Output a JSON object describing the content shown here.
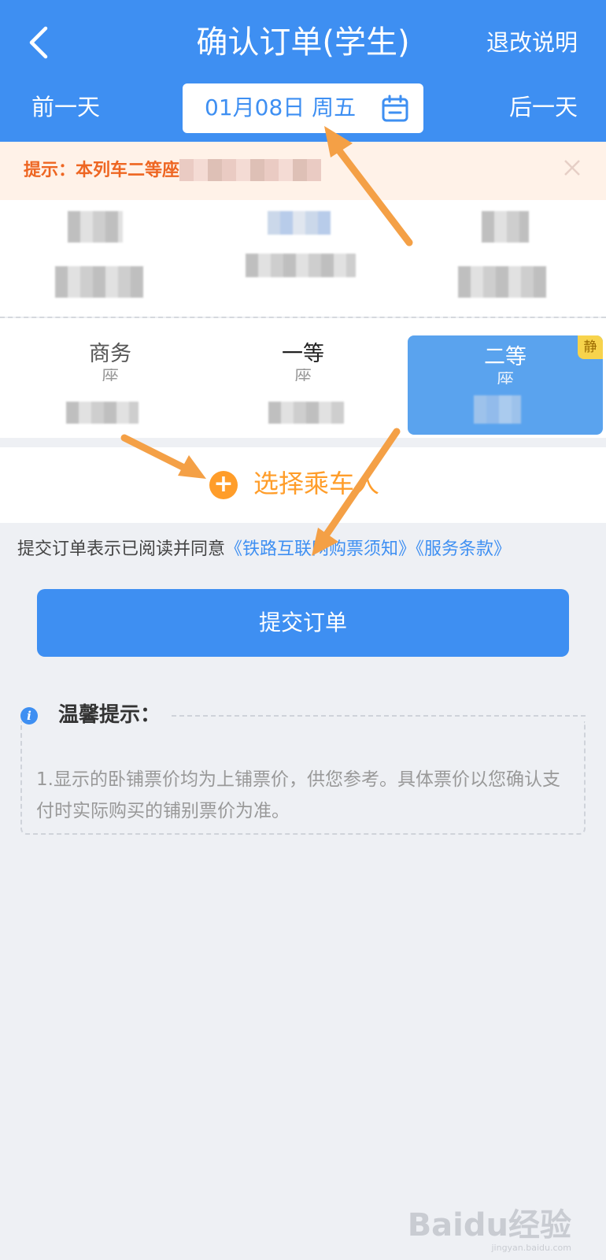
{
  "header": {
    "title": "确认订单(学生)",
    "refund_link": "退改说明",
    "prev_day": "前一天",
    "next_day": "后一天",
    "date": "01月08日 周五"
  },
  "notice": {
    "text": "提示：本列车二等座"
  },
  "seats": {
    "business": {
      "name": "商务",
      "suffix": "座"
    },
    "first": {
      "name": "一等",
      "suffix": "座"
    },
    "second": {
      "name": "二等",
      "suffix": "座",
      "badge": "静"
    }
  },
  "passenger": {
    "select_label": "选择乘车人"
  },
  "agreement": {
    "prefix": "提交订单表示已阅读并同意",
    "link1": "《铁路互联网购票须知》",
    "link2": "《服务条款》"
  },
  "submit": {
    "label": "提交订单"
  },
  "tips": {
    "title": "温馨提示：",
    "text": "1.显示的卧铺票价均为上铺票价，供您参考。具体票价以您确认支付时实际购买的铺别票价为准。"
  },
  "watermark": {
    "logo": "Baidu经验",
    "sub": "jingyan.baidu.com"
  },
  "colors": {
    "primary": "#3e8ff2",
    "accent": "#ff9d2a",
    "notice_text": "#ee6622",
    "notice_bg": "#fff2e8",
    "selected_seat": "#5aa3ee",
    "arrow": "#f4a046"
  }
}
